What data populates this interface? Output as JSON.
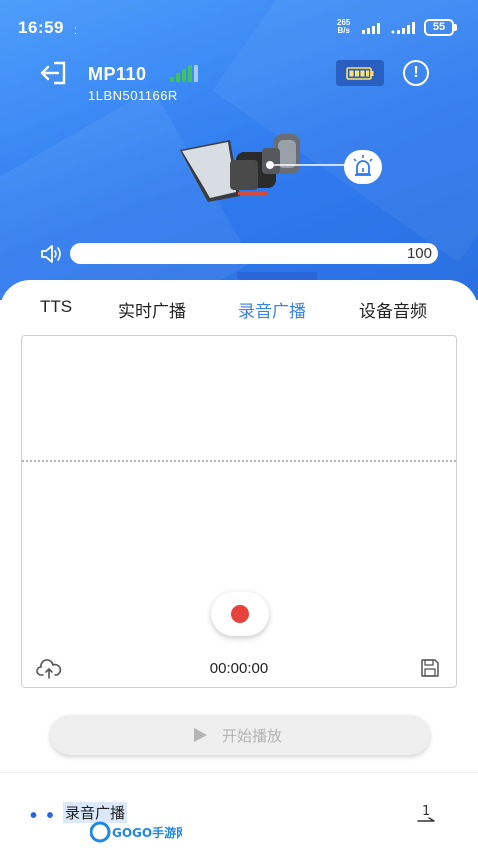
{
  "status_bar": {
    "time": "16:59",
    "indicator": "⁚",
    "net_speed_value": "265",
    "net_speed_unit": "B/s",
    "battery_level": "55"
  },
  "device": {
    "name": "MP110",
    "serial": "1LBN501166R",
    "signal_level": 4,
    "signal_max": 4
  },
  "volume": {
    "value": "100",
    "level_fraction": 1.0
  },
  "tabs": [
    {
      "label": "TTS",
      "active": false
    },
    {
      "label": "实时广播",
      "active": false
    },
    {
      "label": "录音广播",
      "active": true
    },
    {
      "label": "设备音频",
      "active": false
    }
  ],
  "recorder": {
    "timer": "00:00:00"
  },
  "play_button": {
    "label": "开始播放"
  },
  "footer": {
    "dots": "• • •",
    "label": "录音广播",
    "watermark": "GOGO手游网",
    "page_number": "1"
  },
  "colors": {
    "header_blue": "#2f7bef",
    "active_tab": "#3b83e6",
    "record_red": "#e8423c",
    "signal_green": "#3ec35a"
  }
}
